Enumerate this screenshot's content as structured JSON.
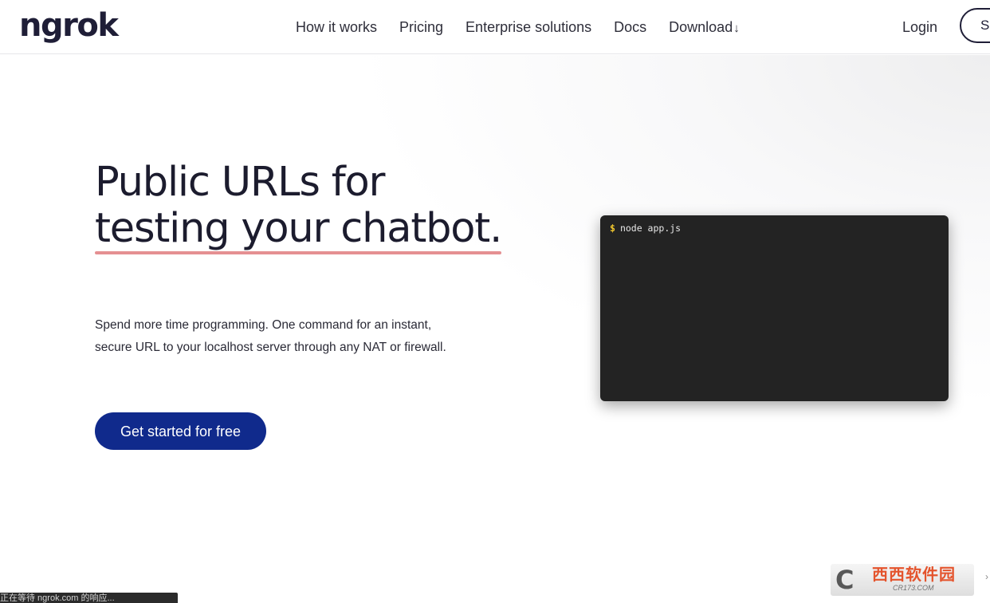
{
  "header": {
    "logo": "ngrok",
    "nav": [
      {
        "label": "How it works"
      },
      {
        "label": "Pricing"
      },
      {
        "label": "Enterprise solutions"
      },
      {
        "label": "Docs"
      },
      {
        "label": "Download",
        "icon": "arrow-down-icon"
      }
    ],
    "login_label": "Login",
    "signup_label": "Si"
  },
  "hero": {
    "headline_line1": "Public URLs for",
    "headline_line2": "testing your chatbot.",
    "underline_color": "#e59092",
    "lead": "Spend more time programming. One command for an instant, secure URL to your localhost server through any NAT or firewall.",
    "cta_label": "Get started for free",
    "cta_color": "#102a8c"
  },
  "terminal": {
    "prompt": "$",
    "command": "node app.js"
  },
  "status_bar": {
    "text": "正在等待 ngrok.com 的响应..."
  },
  "watermark": {
    "mark": "C",
    "text": "西西软件园",
    "sub": "CR173.COM"
  }
}
